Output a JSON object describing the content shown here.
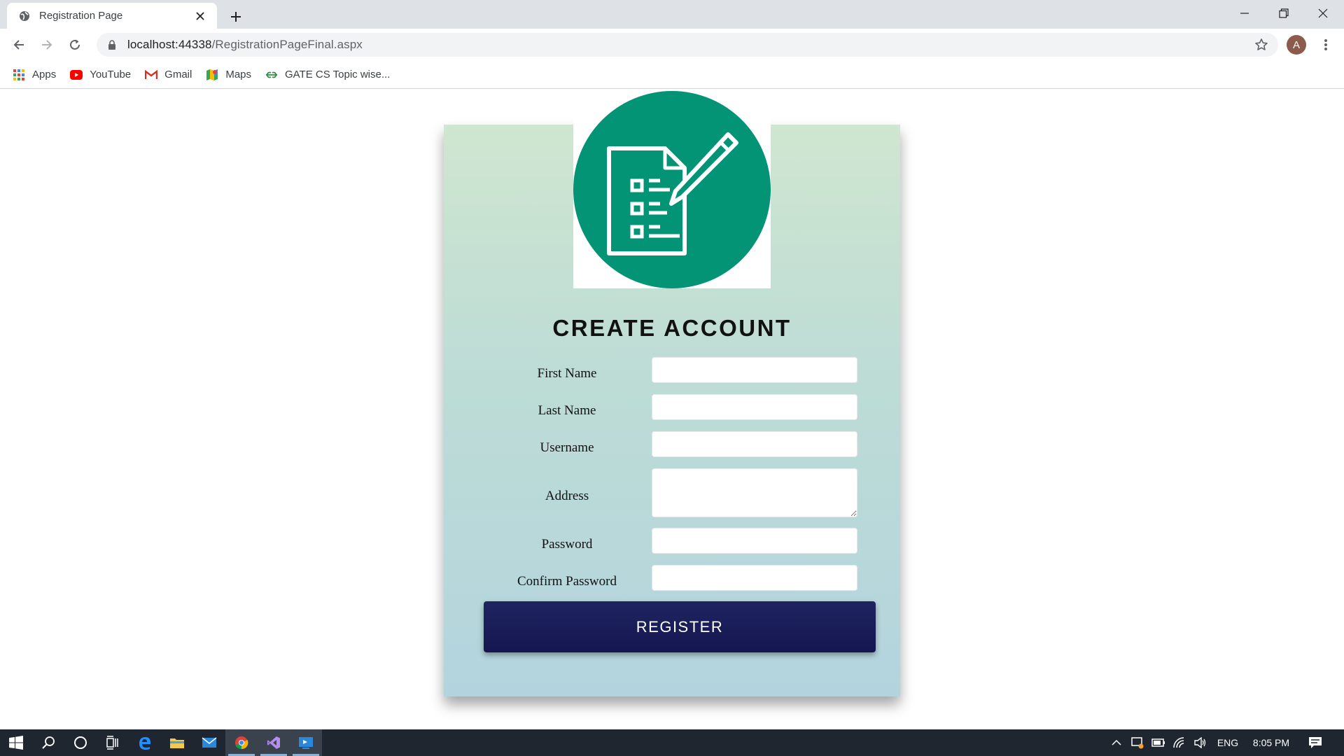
{
  "browser": {
    "tab_title": "Registration Page",
    "url_host": "localhost:44338",
    "url_path": "/RegistrationPageFinal.aspx",
    "profile_initial": "A",
    "bookmarks": [
      {
        "label": "Apps",
        "icon": "apps-grid-icon"
      },
      {
        "label": "YouTube",
        "icon": "youtube-icon"
      },
      {
        "label": "Gmail",
        "icon": "gmail-icon"
      },
      {
        "label": "Maps",
        "icon": "maps-icon"
      },
      {
        "label": "GATE CS Topic wise...",
        "icon": "geeksforgeeks-icon"
      }
    ]
  },
  "form": {
    "heading": "CREATE ACCOUNT",
    "labels": {
      "first_name": "First Name",
      "last_name": "Last Name",
      "username": "Username",
      "address": "Address",
      "password": "Password",
      "confirm_password": "Confirm Password"
    },
    "values": {
      "first_name": "",
      "last_name": "",
      "username": "",
      "address": "",
      "password": "",
      "confirm_password": ""
    },
    "register_label": "REGISTER"
  },
  "taskbar": {
    "language": "ENG",
    "time": "8:05 PM"
  },
  "colors": {
    "logo_green": "#029475",
    "button_navy": "#1a1d58",
    "card_top": "#cfe6d0",
    "card_bottom": "#b3d4de"
  }
}
